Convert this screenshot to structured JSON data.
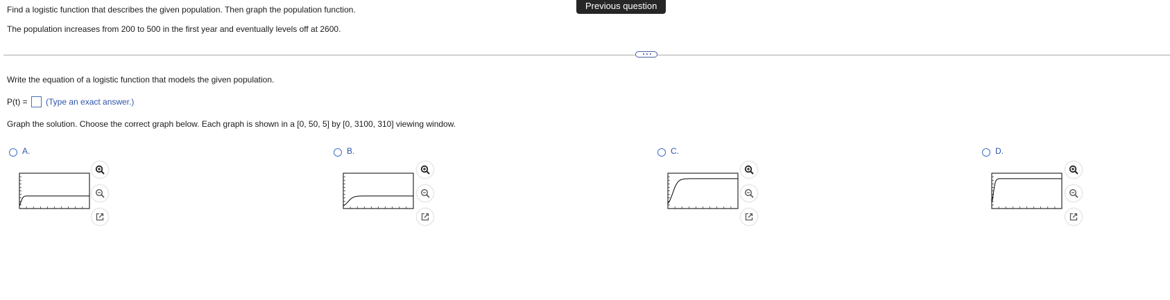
{
  "header": {
    "prompt_line1": "Find a logistic function that describes the given population. Then graph the population function.",
    "prompt_line2": "The population increases from 200 to 500 in the first year and eventually levels off at 2600.",
    "previous_question_label": "Previous question"
  },
  "question": {
    "instruction": "Write the equation of a logistic function that models the given population.",
    "answer_prefix": "P(t) =",
    "answer_value": "",
    "answer_hint": "(Type an exact answer.)",
    "graph_instruction": "Graph the solution. Choose the correct graph below. Each graph is shown in a [0, 50, 5] by [0, 3100, 310] viewing window."
  },
  "options": [
    {
      "label": "A.",
      "selected": false,
      "plateau_fraction": 0.33,
      "rise": "fast"
    },
    {
      "label": "B.",
      "selected": false,
      "plateau_fraction": 0.33,
      "rise": "slow"
    },
    {
      "label": "C.",
      "selected": false,
      "plateau_fraction": 0.84,
      "rise": "slow"
    },
    {
      "label": "D.",
      "selected": false,
      "plateau_fraction": 0.84,
      "rise": "fast"
    }
  ],
  "icons": {
    "zoom_in": "zoom-in-icon",
    "zoom_out": "zoom-out-icon",
    "popout": "external-link-icon"
  },
  "colors": {
    "link_blue": "#2c54a8",
    "button_dark": "#262626",
    "curve": "#000000"
  }
}
